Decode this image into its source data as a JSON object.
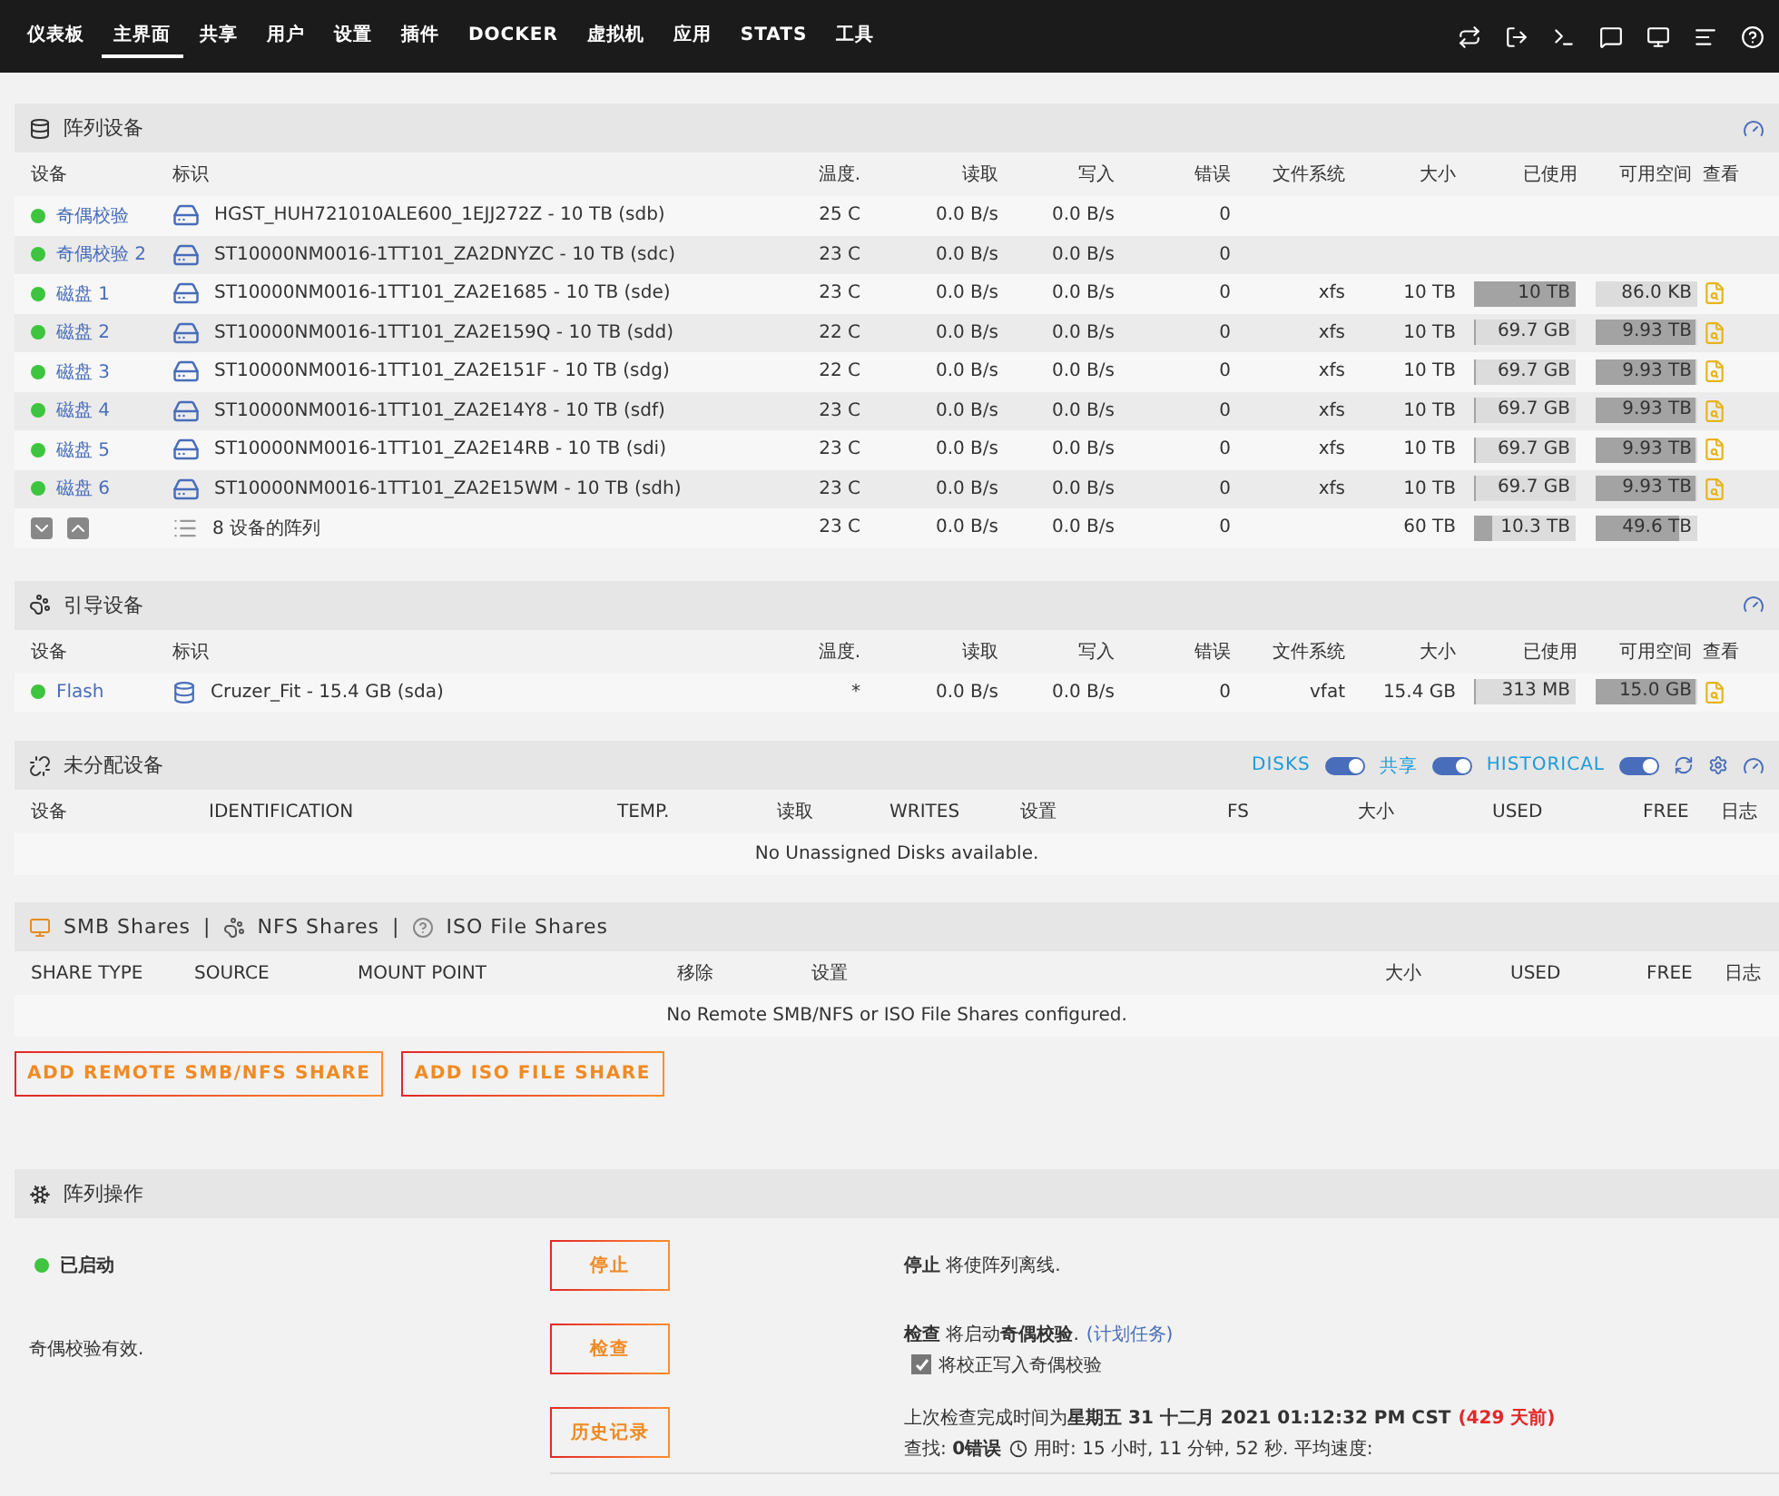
{
  "nav": {
    "items": [
      {
        "label": "仪表板",
        "selected": false
      },
      {
        "label": "主界面",
        "selected": true
      },
      {
        "label": "共享",
        "selected": false
      },
      {
        "label": "用户",
        "selected": false
      },
      {
        "label": "设置",
        "selected": false
      },
      {
        "label": "插件",
        "selected": false
      },
      {
        "label": "DOCKER",
        "selected": false
      },
      {
        "label": "虚拟机",
        "selected": false
      },
      {
        "label": "应用",
        "selected": false
      },
      {
        "label": "STATS",
        "selected": false
      },
      {
        "label": "工具",
        "selected": false
      }
    ]
  },
  "array_devices": {
    "title": "阵列设备",
    "columns": [
      "设备",
      "标识",
      "温度.",
      "读取",
      "写入",
      "错误",
      "文件系统",
      "大小",
      "已使用",
      "可用空间",
      "查看"
    ],
    "rows": [
      {
        "kind": "disk",
        "online": true,
        "device": "奇偶校验",
        "identifier": "HGST_HUH721010ALE600_1EJJ272Z - 10 TB (sdb)",
        "temp": "25 C",
        "read": "0.0 B/s",
        "write": "0.0 B/s",
        "errors": "0"
      },
      {
        "kind": "disk",
        "online": true,
        "device": "奇偶校验 2",
        "identifier": "ST10000NM0016-1TT101_ZA2DNYZC - 10 TB (sdc)",
        "temp": "23 C",
        "read": "0.0 B/s",
        "write": "0.0 B/s",
        "errors": "0"
      },
      {
        "kind": "disk",
        "online": true,
        "device": "磁盘 1",
        "identifier": "ST10000NM0016-1TT101_ZA2E1685 - 10 TB (sde)",
        "temp": "23 C",
        "read": "0.0 B/s",
        "write": "0.0 B/s",
        "errors": "0",
        "fs": "xfs",
        "size": "10 TB",
        "used": {
          "text": "10 TB",
          "level": 1
        },
        "free": {
          "text": "86.0 KB",
          "level": 0
        },
        "viewable": true
      },
      {
        "kind": "disk",
        "online": true,
        "device": "磁盘 2",
        "identifier": "ST10000NM0016-1TT101_ZA2E159Q - 10 TB (sdd)",
        "temp": "22 C",
        "read": "0.0 B/s",
        "write": "0.0 B/s",
        "errors": "0",
        "fs": "xfs",
        "size": "10 TB",
        "used": {
          "text": "69.7 GB",
          "level": 0.01
        },
        "free": {
          "text": "9.93 TB",
          "level": 0.99
        },
        "viewable": true
      },
      {
        "kind": "disk",
        "online": true,
        "device": "磁盘 3",
        "identifier": "ST10000NM0016-1TT101_ZA2E151F - 10 TB (sdg)",
        "temp": "22 C",
        "read": "0.0 B/s",
        "write": "0.0 B/s",
        "errors": "0",
        "fs": "xfs",
        "size": "10 TB",
        "used": {
          "text": "69.7 GB",
          "level": 0.01
        },
        "free": {
          "text": "9.93 TB",
          "level": 0.99
        },
        "viewable": true
      },
      {
        "kind": "disk",
        "online": true,
        "device": "磁盘 4",
        "identifier": "ST10000NM0016-1TT101_ZA2E14Y8 - 10 TB (sdf)",
        "temp": "23 C",
        "read": "0.0 B/s",
        "write": "0.0 B/s",
        "errors": "0",
        "fs": "xfs",
        "size": "10 TB",
        "used": {
          "text": "69.7 GB",
          "level": 0.01
        },
        "free": {
          "text": "9.93 TB",
          "level": 0.99
        },
        "viewable": true
      },
      {
        "kind": "disk",
        "online": true,
        "device": "磁盘 5",
        "identifier": "ST10000NM0016-1TT101_ZA2E14RB - 10 TB (sdi)",
        "temp": "23 C",
        "read": "0.0 B/s",
        "write": "0.0 B/s",
        "errors": "0",
        "fs": "xfs",
        "size": "10 TB",
        "used": {
          "text": "69.7 GB",
          "level": 0.01
        },
        "free": {
          "text": "9.93 TB",
          "level": 0.99
        },
        "viewable": true
      },
      {
        "kind": "disk",
        "online": true,
        "device": "磁盘 6",
        "identifier": "ST10000NM0016-1TT101_ZA2E15WM - 10 TB (sdh)",
        "temp": "23 C",
        "read": "0.0 B/s",
        "write": "0.0 B/s",
        "errors": "0",
        "fs": "xfs",
        "size": "10 TB",
        "used": {
          "text": "69.7 GB",
          "level": 0.01
        },
        "free": {
          "text": "9.93 TB",
          "level": 0.99
        },
        "viewable": true
      },
      {
        "kind": "total",
        "identifier": "8 设备的阵列",
        "temp": "23 C",
        "read": "0.0 B/s",
        "write": "0.0 B/s",
        "errors": "0",
        "size": "60 TB",
        "used": {
          "text": "10.3 TB",
          "level": 0.17
        },
        "free": {
          "text": "49.6 TB",
          "level": 0.83
        }
      }
    ]
  },
  "boot_device": {
    "title": "引导设备",
    "columns": [
      "设备",
      "标识",
      "温度.",
      "读取",
      "写入",
      "错误",
      "文件系统",
      "大小",
      "已使用",
      "可用空间",
      "查看"
    ],
    "rows": [
      {
        "kind": "usb",
        "online": true,
        "device": "Flash",
        "identifier": "Cruzer_Fit - 15.4 GB (sda)",
        "temp": "*",
        "read": "0.0 B/s",
        "write": "0.0 B/s",
        "errors": "0",
        "fs": "vfat",
        "size": "15.4 GB",
        "used": {
          "text": "313 MB",
          "level": 0.02
        },
        "free": {
          "text": "15.0 GB",
          "level": 0.98
        },
        "viewable": true
      }
    ]
  },
  "unassigned": {
    "title": "未分配设备",
    "toggles": [
      {
        "label": "DISKS",
        "on": true
      },
      {
        "label": "共享",
        "on": true
      },
      {
        "label": "HISTORICAL",
        "on": true
      }
    ],
    "columns": [
      "设备",
      "IDENTIFICATION",
      "TEMP.",
      "读取",
      "WRITES",
      "设置",
      "FS",
      "大小",
      "USED",
      "FREE",
      "日志"
    ],
    "empty_message": "No Unassigned Disks available."
  },
  "shares": {
    "tabs": [
      "SMB Shares",
      "NFS Shares",
      "ISO File Shares"
    ],
    "separator": "|",
    "columns": [
      "SHARE TYPE",
      "SOURCE",
      "MOUNT POINT",
      "移除",
      "设置",
      "大小",
      "USED",
      "FREE",
      "日志"
    ],
    "empty_message": "No Remote SMB/NFS or ISO File Shares configured.",
    "buttons": [
      "ADD REMOTE SMB/NFS SHARE",
      "ADD ISO FILE SHARE"
    ]
  },
  "array_operation": {
    "title": "阵列操作",
    "status": {
      "label": "已启动",
      "online": true
    },
    "parity_note": "奇偶校验有效.",
    "stop": {
      "button": "停止",
      "description": "**停止** 将使阵列离线."
    },
    "check": {
      "button": "检查",
      "description": "**检查** 将启动**奇偶校验**.",
      "link": "(计划任务)",
      "checkbox": {
        "label": "将校正写入奇偶校验",
        "checked": true
      }
    },
    "history": {
      "button": "历史记录",
      "last_check": "上次检查完成时间为**星期五 31 十二月 2021 01:12:32 PM CST**",
      "age": "(429 天前)",
      "found": "查找: **0错误**",
      "duration": "用时: 15 小时, 11 分钟, 52 秒. 平均速度:"
    }
  }
}
